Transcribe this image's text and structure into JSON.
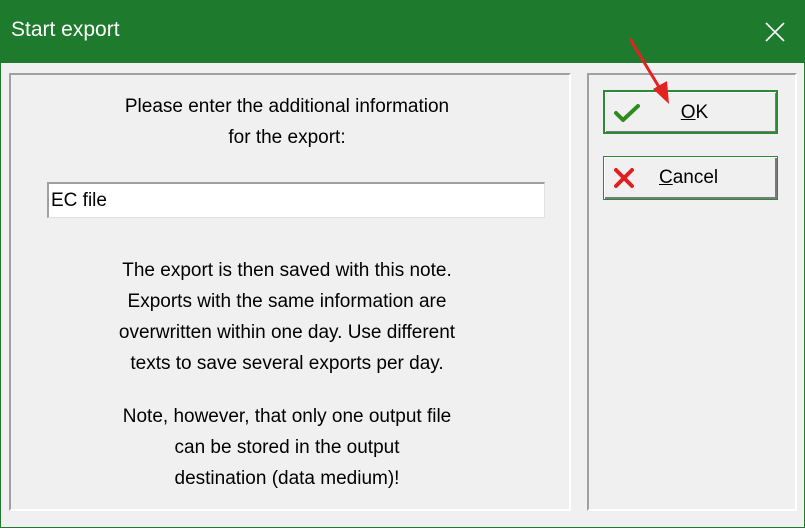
{
  "window": {
    "title": "Start export"
  },
  "icons": {
    "close": "close-icon",
    "ok": "checkmark-icon",
    "cancel": "cross-icon",
    "annotation": "red-arrow"
  },
  "colors": {
    "titlebar": "#1e7a2c",
    "button_border": "#2a8a35",
    "check": "#2e8b1e",
    "cross": "#e02020",
    "annotation_arrow": "#e32222"
  },
  "dialog": {
    "prompt": "Please enter the additional information\nfor the export:",
    "input_value": "EC file",
    "info": "The export is then saved with this note.\nExports with the same information are\noverwritten within one day. Use different\ntexts to save several exports per day.",
    "note": "Note, however, that only one output file\ncan be stored in the output\ndestination (data medium)!"
  },
  "buttons": {
    "ok": {
      "mnemonic": "O",
      "rest": "K"
    },
    "cancel": {
      "mnemonic": "C",
      "rest": "ancel"
    }
  }
}
